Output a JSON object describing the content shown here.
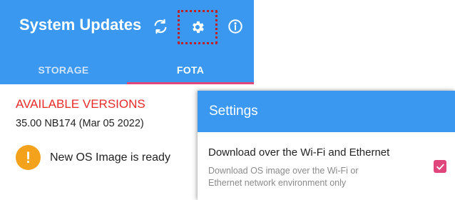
{
  "app_bar": {
    "title": "System Updates",
    "icons": {
      "refresh": "refresh-icon",
      "settings": "gear-icon",
      "info": "info-icon"
    }
  },
  "tabs": [
    {
      "label": "STORAGE",
      "selected": false
    },
    {
      "label": "FOTA",
      "selected": true
    }
  ],
  "content": {
    "heading": "AVAILABLE VERSIONS",
    "version": "35.00 NB174 (Mar 05 2022)",
    "status_icon": "!",
    "status_text": "New OS Image is ready"
  },
  "settings_dialog": {
    "title": "Settings",
    "option_title": "Download over the Wi-Fi and Ethernet",
    "option_description": "Download OS image over the Wi-Fi or Ethernet network environment only",
    "checked": true
  },
  "colors": {
    "primary": "#3b98f1",
    "accent": "#e0457b",
    "heading_red": "#ea2a2a",
    "warning": "#f4a21c",
    "highlight_border": "#c0202a"
  }
}
